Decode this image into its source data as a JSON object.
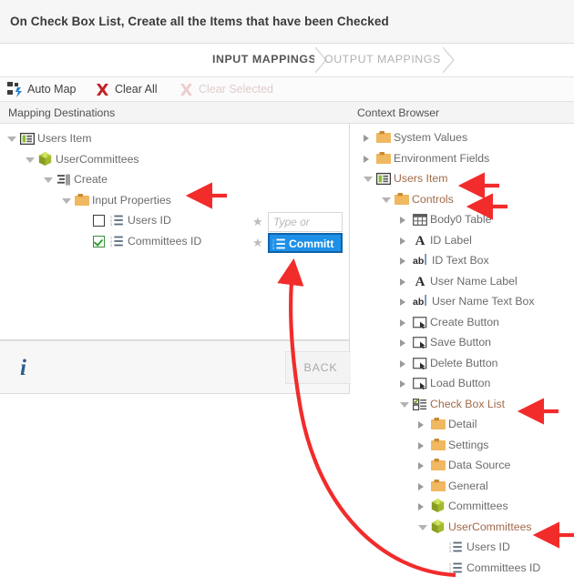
{
  "header": {
    "title": "On Check Box List, Create all the Items that have been Checked"
  },
  "tabs": [
    {
      "label": "INPUT MAPPINGS",
      "active": true
    },
    {
      "label": "OUTPUT MAPPINGS",
      "active": false
    }
  ],
  "toolbar": {
    "auto_map": "Auto Map",
    "clear_all": "Clear All",
    "clear_selected": "Clear Selected"
  },
  "columns": {
    "left": "Mapping Destinations",
    "right": "Context Browser"
  },
  "mapping_tree": [
    {
      "label": "Users Item",
      "depth": 0,
      "icon": "item-icon",
      "expander": "open"
    },
    {
      "label": "UserCommittees",
      "depth": 1,
      "icon": "cube-icon",
      "expander": "open"
    },
    {
      "label": "Create",
      "depth": 2,
      "icon": "create-icon",
      "expander": "open"
    },
    {
      "label": "Input Properties",
      "depth": 3,
      "icon": "folder-icon",
      "expander": "open"
    },
    {
      "label": "Users ID",
      "depth": 4,
      "icon": "list-icon",
      "expander": "none",
      "checkbox": "unchecked"
    },
    {
      "label": "Committees ID",
      "depth": 4,
      "icon": "list-icon",
      "expander": "none",
      "checkbox": "checked"
    }
  ],
  "mapping_values": [
    {
      "row": "Users ID",
      "required": "★",
      "placeholder": "Type or",
      "value": "",
      "selected": false
    },
    {
      "row": "Committees ID",
      "required": "★",
      "placeholder": "",
      "value": "Committ",
      "selected": true
    }
  ],
  "context_tree": [
    {
      "label": "System Values",
      "depth": 0,
      "icon": "folder-icon",
      "expander": "closed"
    },
    {
      "label": "Environment Fields",
      "depth": 0,
      "icon": "folder-icon",
      "expander": "closed"
    },
    {
      "label": "Users Item",
      "depth": 0,
      "icon": "item-icon",
      "expander": "open",
      "accent": true
    },
    {
      "label": "Controls",
      "depth": 1,
      "icon": "folder-icon",
      "expander": "open",
      "accent": true
    },
    {
      "label": "Body0 Table",
      "depth": 2,
      "icon": "table-icon",
      "expander": "closed"
    },
    {
      "label": "ID Label",
      "depth": 2,
      "icon": "label-icon",
      "expander": "closed"
    },
    {
      "label": "ID Text Box",
      "depth": 2,
      "icon": "textbox-icon",
      "expander": "closed"
    },
    {
      "label": "User Name Label",
      "depth": 2,
      "icon": "label-icon",
      "expander": "closed"
    },
    {
      "label": "User Name Text Box",
      "depth": 2,
      "icon": "textbox-icon",
      "expander": "closed"
    },
    {
      "label": "Create Button",
      "depth": 2,
      "icon": "button-icon",
      "expander": "closed"
    },
    {
      "label": "Save Button",
      "depth": 2,
      "icon": "button-icon",
      "expander": "closed"
    },
    {
      "label": "Delete Button",
      "depth": 2,
      "icon": "button-icon",
      "expander": "closed"
    },
    {
      "label": "Load Button",
      "depth": 2,
      "icon": "button-icon",
      "expander": "closed"
    },
    {
      "label": "Check Box List",
      "depth": 2,
      "icon": "checklist-icon",
      "expander": "open",
      "accent": true
    },
    {
      "label": "Detail",
      "depth": 3,
      "icon": "folder-icon",
      "expander": "closed"
    },
    {
      "label": "Settings",
      "depth": 3,
      "icon": "folder-icon",
      "expander": "closed"
    },
    {
      "label": "Data Source",
      "depth": 3,
      "icon": "folder-icon",
      "expander": "closed"
    },
    {
      "label": "General",
      "depth": 3,
      "icon": "folder-icon",
      "expander": "closed"
    },
    {
      "label": "Committees",
      "depth": 3,
      "icon": "cube-icon",
      "expander": "closed"
    },
    {
      "label": "UserCommittees",
      "depth": 3,
      "icon": "cube-icon",
      "expander": "open",
      "accent": true
    },
    {
      "label": "Users ID",
      "depth": 4,
      "icon": "list-icon",
      "expander": "none"
    },
    {
      "label": "Committees ID",
      "depth": 4,
      "icon": "list-icon",
      "expander": "none"
    }
  ],
  "footer": {
    "info_icon": "info-icon",
    "back_label": "BACK"
  },
  "annotations": {
    "color": "#f22b2b",
    "arrows": [
      {
        "name": "arrow-input-properties",
        "target": "Input Properties"
      },
      {
        "name": "arrow-users-item",
        "target": "Users Item"
      },
      {
        "name": "arrow-controls",
        "target": "Controls"
      },
      {
        "name": "arrow-check-box-list",
        "target": "Check Box List"
      },
      {
        "name": "arrow-usercommittees",
        "target": "UserCommittees"
      },
      {
        "name": "arrow-drag-curve",
        "target": "Committees ID → value box"
      }
    ]
  }
}
